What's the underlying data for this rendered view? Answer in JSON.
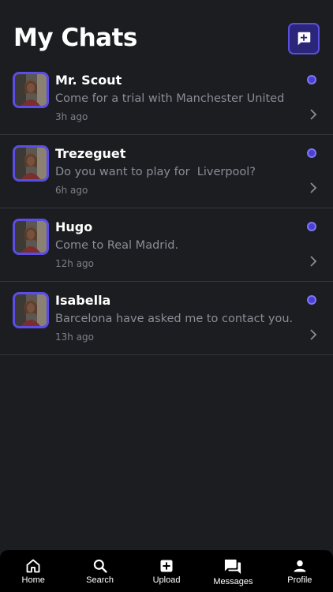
{
  "header": {
    "title": "My Chats",
    "new_chat_icon": "add-message-icon"
  },
  "chats": [
    {
      "name": "Mr. Scout",
      "message": "Come for a trial with Manchester United",
      "time": "3h ago",
      "unread": true
    },
    {
      "name": "Trezeguet",
      "message": "Do you want to play for  Liverpool?",
      "time": "6h ago",
      "unread": true
    },
    {
      "name": "Hugo",
      "message": "Come to Real Madrid.",
      "time": "12h ago",
      "unread": true
    },
    {
      "name": "Isabella",
      "message": "Barcelona have asked me to contact you.",
      "time": "13h ago",
      "unread": true
    }
  ],
  "nav": [
    {
      "label": "Home",
      "icon": "home-icon"
    },
    {
      "label": "Search",
      "icon": "search-icon"
    },
    {
      "label": "Upload",
      "icon": "upload-icon"
    },
    {
      "label": "Messages",
      "icon": "messages-icon"
    },
    {
      "label": "Profile",
      "icon": "profile-icon"
    }
  ],
  "colors": {
    "background": "#1c1d21",
    "accent": "#5b4ee6",
    "nav_background": "#000000"
  }
}
